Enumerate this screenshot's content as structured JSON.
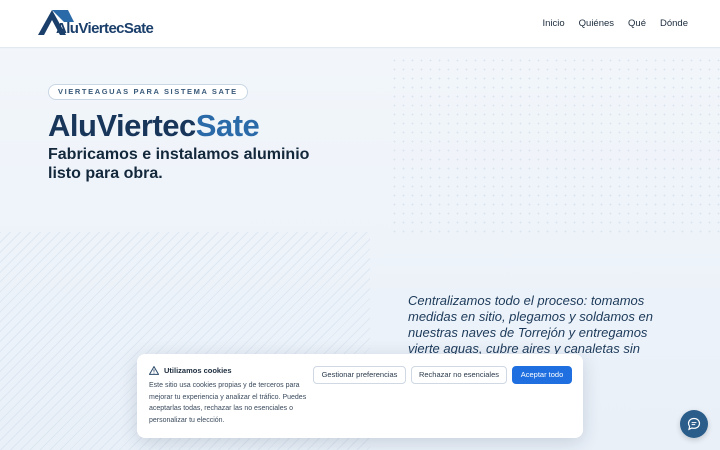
{
  "header": {
    "brand": "AluViertecSate",
    "nav": [
      "Inicio",
      "Quiénes",
      "Qué",
      "Dónde"
    ]
  },
  "hero": {
    "badge": "VIERTEAGUAS PARA SISTEMA SATE",
    "title_part1": "AluViertec",
    "title_part2": "Sate",
    "subtitle": "Fabricamos e instalamos aluminio listo para obra.",
    "description": "Centralizamos todo el proceso: tomamos medidas en sitio, plegamos y soldamos en nuestras naves de Torrejón y entregamos vierte aguas, cubre aires y canaletas sin"
  },
  "cookie": {
    "title": "Utilizamos cookies",
    "body": "Este sitio usa cookies propias y de terceros para mejorar tu experiencia y analizar el tráfico. Puedes aceptarlas todas, rechazar las no esenciales o personalizar tu elección.",
    "manage_label": "Gestionar preferencias",
    "reject_label": "Rechazar no esenciales",
    "accept_label": "Aceptar todo"
  },
  "icons": {
    "logo": "roof-logo-icon",
    "cookie": "warning-triangle-icon",
    "chat": "chat-bubble-icon"
  },
  "colors": {
    "brand_dark": "#17365a",
    "brand_accent": "#2b6aa8",
    "accept_button": "#1f6fe0",
    "chat_button": "#2a5d8a"
  }
}
